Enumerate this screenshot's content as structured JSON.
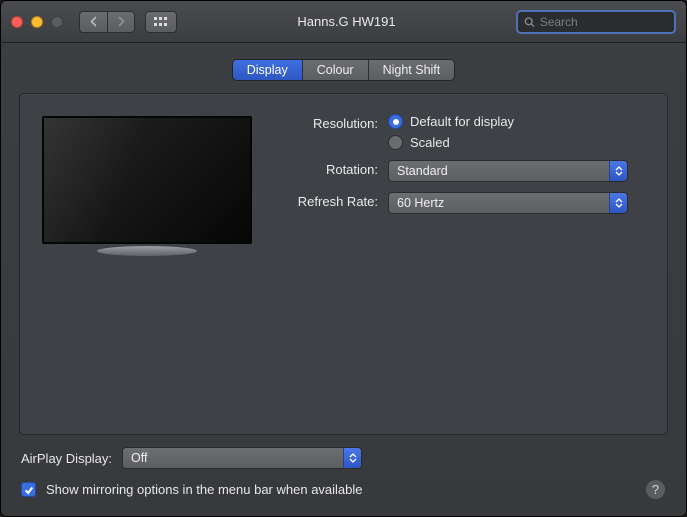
{
  "window": {
    "title": "Hanns.G HW191",
    "search_placeholder": "Search"
  },
  "tabs": {
    "display": "Display",
    "colour": "Colour",
    "night_shift": "Night Shift"
  },
  "settings": {
    "resolution_label": "Resolution:",
    "resolution_default": "Default for display",
    "resolution_scaled": "Scaled",
    "rotation_label": "Rotation:",
    "rotation_value": "Standard",
    "refresh_label": "Refresh Rate:",
    "refresh_value": "60 Hertz"
  },
  "airplay": {
    "label": "AirPlay Display:",
    "value": "Off"
  },
  "mirroring": {
    "label": "Show mirroring options in the menu bar when available"
  },
  "help_glyph": "?"
}
